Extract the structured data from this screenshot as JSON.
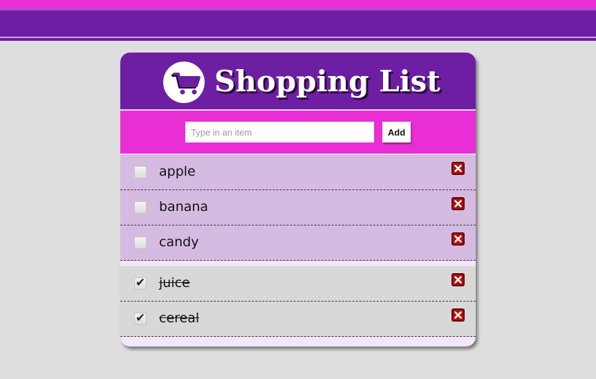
{
  "app": {
    "title": "Shopping List"
  },
  "form": {
    "placeholder": "Type in an item",
    "value": "",
    "add_label": "Add"
  },
  "pending_items": [
    {
      "label": "apple",
      "checked": false
    },
    {
      "label": "banana",
      "checked": false
    },
    {
      "label": "candy",
      "checked": false
    }
  ],
  "completed_items": [
    {
      "label": "juice",
      "checked": true
    },
    {
      "label": "cereal",
      "checked": true
    }
  ],
  "icons": {
    "logo": "shopping-cart-icon",
    "remove": "close-icon",
    "check": "checkmark-icon"
  },
  "colors": {
    "primary_purple": "#6d1ea3",
    "accent_pink": "#e92ed6",
    "pending_row": "#d5bbe2",
    "completed_row": "#d8d8d8",
    "delete_red": "#b01010"
  },
  "check_glyph": "✔"
}
